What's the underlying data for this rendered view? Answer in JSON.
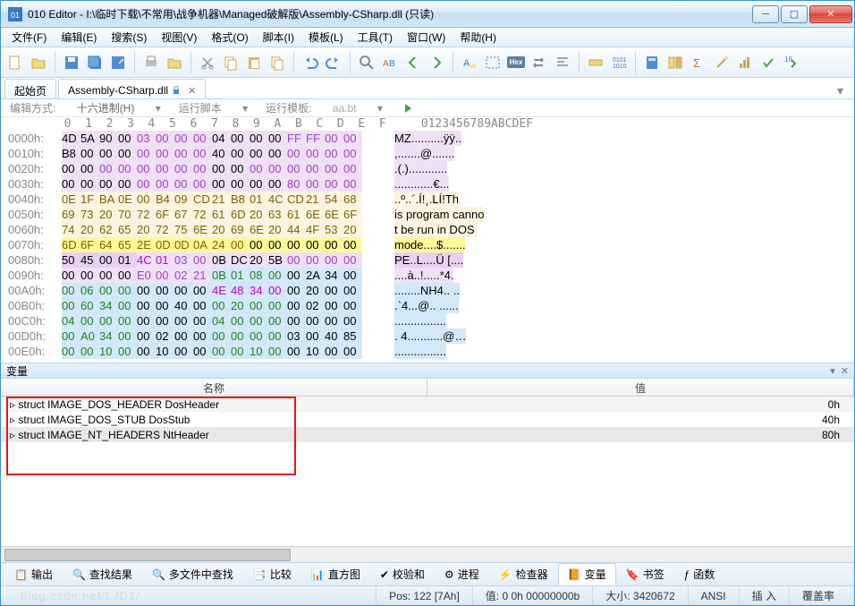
{
  "title": "010 Editor - I:\\临时下载\\不常用\\战争机器\\Managed破解版\\Assembly-CSharp.dll  (只读)",
  "menu": [
    "文件(F)",
    "编辑(E)",
    "搜索(S)",
    "视图(V)",
    "格式(O)",
    "脚本(I)",
    "模板(L)",
    "工具(T)",
    "窗口(W)",
    "帮助(H)"
  ],
  "tabs": {
    "start": "起始页",
    "file": "Assembly-CSharp.dll"
  },
  "hexhdr": {
    "mode_lbl": "编辑方式:",
    "mode": "十六进制(H)",
    "script_lbl": "运行脚本",
    "tpl_lbl": "运行模板:",
    "tpl": "aa.bt"
  },
  "ruler": "        0  1  2  3  4  5  6  7  8  9  A  B  C  D  E  F     0123456789ABCDEF",
  "rows": [
    {
      "a": "0000h:",
      "b": [
        "4D",
        "5A",
        "90",
        "00",
        "03",
        "00",
        "00",
        "00",
        "04",
        "00",
        "00",
        "00",
        "FF",
        "FF",
        "00",
        "00"
      ],
      "c": [
        "lav",
        "lav",
        "lav",
        "lav",
        "lav",
        "lav",
        "lav",
        "lav",
        "lav",
        "lav",
        "lav",
        "lav",
        "lav",
        "lav",
        "lav",
        "lav"
      ],
      "f": [
        "blk",
        "blk",
        "blk",
        "blk",
        "pur",
        "pur",
        "pur",
        "pur",
        "blk",
        "blk",
        "blk",
        "blk",
        "pur",
        "pur",
        "pur",
        "pur"
      ],
      "t": "MZ..........ÿÿ.."
    },
    {
      "a": "0010h:",
      "b": [
        "B8",
        "00",
        "00",
        "00",
        "00",
        "00",
        "00",
        "00",
        "40",
        "00",
        "00",
        "00",
        "00",
        "00",
        "00",
        "00"
      ],
      "c": [
        "lav",
        "lav",
        "lav",
        "lav",
        "lav",
        "lav",
        "lav",
        "lav",
        "lav",
        "lav",
        "lav",
        "lav",
        "lav",
        "lav",
        "lav",
        "lav"
      ],
      "f": [
        "blk",
        "blk",
        "blk",
        "blk",
        "pur",
        "pur",
        "pur",
        "pur",
        "blk",
        "blk",
        "blk",
        "blk",
        "pur",
        "pur",
        "pur",
        "pur"
      ],
      "t": ",.......@......."
    },
    {
      "a": "0020h:",
      "b": [
        "00",
        "00",
        "00",
        "00",
        "00",
        "00",
        "00",
        "00",
        "00",
        "00",
        "00",
        "00",
        "00",
        "00",
        "00",
        "00"
      ],
      "c": [
        "lav",
        "lav",
        "lav",
        "lav",
        "lav",
        "lav",
        "lav",
        "lav",
        "lav",
        "lav",
        "lav",
        "lav",
        "lav",
        "lav",
        "lav",
        "lav"
      ],
      "f": [
        "blk",
        "blk",
        "pur",
        "pur",
        "pur",
        "pur",
        "pur",
        "pur",
        "blk",
        "blk",
        "pur",
        "pur",
        "pur",
        "pur",
        "pur",
        "pur"
      ],
      "t": ".(.)............"
    },
    {
      "a": "0030h:",
      "b": [
        "00",
        "00",
        "00",
        "00",
        "00",
        "00",
        "00",
        "00",
        "00",
        "00",
        "00",
        "00",
        "80",
        "00",
        "00",
        "00"
      ],
      "c": [
        "lav",
        "lav",
        "lav",
        "lav",
        "lav",
        "lav",
        "lav",
        "lav",
        "lav",
        "lav",
        "lav",
        "lav",
        "lav",
        "lav",
        "lav",
        "lav"
      ],
      "f": [
        "blk",
        "blk",
        "blk",
        "blk",
        "pur",
        "pur",
        "pur",
        "pur",
        "blk",
        "blk",
        "blk",
        "blk",
        "pur",
        "pur",
        "pur",
        "pur"
      ],
      "t": "............€..."
    },
    {
      "a": "0040h:",
      "b": [
        "0E",
        "1F",
        "BA",
        "0E",
        "00",
        "B4",
        "09",
        "CD",
        "21",
        "B8",
        "01",
        "4C",
        "CD",
        "21",
        "54",
        "68"
      ],
      "c": [
        "pale",
        "pale",
        "pale",
        "pale",
        "pale",
        "pale",
        "pale",
        "pale",
        "pale",
        "pale",
        "pale",
        "pale",
        "pale",
        "pale",
        "pale",
        "pale"
      ],
      "f": [
        "brn",
        "brn",
        "brn",
        "brn",
        "brn",
        "brn",
        "brn",
        "brn",
        "brn",
        "brn",
        "brn",
        "brn",
        "brn",
        "brn",
        "brn",
        "brn"
      ],
      "t": "..º..´.Í!¸.LÍ!Th"
    },
    {
      "a": "0050h:",
      "b": [
        "69",
        "73",
        "20",
        "70",
        "72",
        "6F",
        "67",
        "72",
        "61",
        "6D",
        "20",
        "63",
        "61",
        "6E",
        "6E",
        "6F"
      ],
      "c": [
        "pale",
        "pale",
        "pale",
        "pale",
        "pale",
        "pale",
        "pale",
        "pale",
        "pale",
        "pale",
        "pale",
        "pale",
        "pale",
        "pale",
        "pale",
        "pale"
      ],
      "f": [
        "brn",
        "brn",
        "brn",
        "brn",
        "brn",
        "brn",
        "brn",
        "brn",
        "brn",
        "brn",
        "brn",
        "brn",
        "brn",
        "brn",
        "brn",
        "brn"
      ],
      "t": "is program canno"
    },
    {
      "a": "0060h:",
      "b": [
        "74",
        "20",
        "62",
        "65",
        "20",
        "72",
        "75",
        "6E",
        "20",
        "69",
        "6E",
        "20",
        "44",
        "4F",
        "53",
        "20"
      ],
      "c": [
        "pale",
        "pale",
        "pale",
        "pale",
        "pale",
        "pale",
        "pale",
        "pale",
        "pale",
        "pale",
        "pale",
        "pale",
        "pale",
        "pale",
        "pale",
        "pale"
      ],
      "f": [
        "brn",
        "brn",
        "brn",
        "brn",
        "brn",
        "brn",
        "brn",
        "brn",
        "brn",
        "brn",
        "brn",
        "brn",
        "brn",
        "brn",
        "brn",
        "brn"
      ],
      "t": "t be run in DOS "
    },
    {
      "a": "0070h:",
      "b": [
        "6D",
        "6F",
        "64",
        "65",
        "2E",
        "0D",
        "0D",
        "0A",
        "24",
        "00",
        "00",
        "00",
        "00",
        "00",
        "00",
        "00"
      ],
      "c": [
        "yel",
        "yel",
        "yel",
        "yel",
        "yel",
        "yel",
        "yel",
        "yel",
        "yel",
        "yel",
        "yel",
        "yel",
        "yel",
        "yel",
        "yel",
        "yel"
      ],
      "f": [
        "brn",
        "brn",
        "brn",
        "brn",
        "brn",
        "brn",
        "brn",
        "brn",
        "brn",
        "brn",
        "blk",
        "blk",
        "blk",
        "blk",
        "blk",
        "blk"
      ],
      "t": "mode....$......."
    },
    {
      "a": "0080h:",
      "b": [
        "50",
        "45",
        "00",
        "01",
        "4C",
        "01",
        "03",
        "00",
        "0B",
        "DC",
        "20",
        "5B",
        "00",
        "00",
        "00",
        "00"
      ],
      "c": [
        "lav2",
        "lav2",
        "lav2",
        "lav2",
        "lav",
        "lav",
        "lav",
        "lav",
        "lav",
        "lav",
        "lav",
        "lav",
        "lav",
        "lav",
        "lav",
        "lav"
      ],
      "f": [
        "blk",
        "blk",
        "blk",
        "blk",
        "mag",
        "mag",
        "pur",
        "pur",
        "blk",
        "blk",
        "blk",
        "blk",
        "pur",
        "pur",
        "pur",
        "pur"
      ],
      "t": "PE..L....Ü [...."
    },
    {
      "a": "0090h:",
      "b": [
        "00",
        "00",
        "00",
        "00",
        "E0",
        "00",
        "02",
        "21",
        "0B",
        "01",
        "08",
        "00",
        "00",
        "2A",
        "34",
        "00"
      ],
      "c": [
        "lav",
        "lav",
        "lav",
        "lav",
        "lav",
        "lav",
        "lav",
        "lav",
        "blu",
        "blu",
        "blu",
        "blu",
        "blu",
        "blu",
        "blu",
        "blu"
      ],
      "f": [
        "blk",
        "blk",
        "blk",
        "blk",
        "pur",
        "pur",
        "pur",
        "pur",
        "grn",
        "grn",
        "grn",
        "grn",
        "blk",
        "blk",
        "blk",
        "blk"
      ],
      "t": "....à..!.....*4."
    },
    {
      "a": "00A0h:",
      "b": [
        "00",
        "06",
        "00",
        "00",
        "00",
        "00",
        "00",
        "00",
        "4E",
        "48",
        "34",
        "00",
        "00",
        "20",
        "00",
        "00"
      ],
      "c": [
        "blu",
        "blu",
        "blu",
        "blu",
        "blu",
        "blu",
        "blu",
        "blu",
        "blu",
        "blu",
        "blu",
        "blu",
        "blu",
        "blu",
        "blu",
        "blu"
      ],
      "f": [
        "grn",
        "grn",
        "grn",
        "grn",
        "blk",
        "blk",
        "blk",
        "blk",
        "mag",
        "mag",
        "mag",
        "mag",
        "blk",
        "blk",
        "blk",
        "blk"
      ],
      "t": "........NH4.. .."
    },
    {
      "a": "00B0h:",
      "b": [
        "00",
        "60",
        "34",
        "00",
        "00",
        "00",
        "40",
        "00",
        "00",
        "20",
        "00",
        "00",
        "00",
        "02",
        "00",
        "00"
      ],
      "c": [
        "blu",
        "blu",
        "blu",
        "blu",
        "blu",
        "blu",
        "blu",
        "blu",
        "blu",
        "blu",
        "blu",
        "blu",
        "blu",
        "blu",
        "blu",
        "blu"
      ],
      "f": [
        "grn",
        "grn",
        "grn",
        "grn",
        "blk",
        "blk",
        "blk",
        "blk",
        "grn",
        "grn",
        "grn",
        "grn",
        "blk",
        "blk",
        "blk",
        "blk"
      ],
      "t": ".`4...@.. ......"
    },
    {
      "a": "00C0h:",
      "b": [
        "04",
        "00",
        "00",
        "00",
        "00",
        "00",
        "00",
        "00",
        "04",
        "00",
        "00",
        "00",
        "00",
        "00",
        "00",
        "00"
      ],
      "c": [
        "blu",
        "blu",
        "blu",
        "blu",
        "blu",
        "blu",
        "blu",
        "blu",
        "blu",
        "blu",
        "blu",
        "blu",
        "blu",
        "blu",
        "blu",
        "blu"
      ],
      "f": [
        "grn",
        "grn",
        "grn",
        "grn",
        "blk",
        "blk",
        "blk",
        "blk",
        "grn",
        "grn",
        "grn",
        "grn",
        "blk",
        "blk",
        "blk",
        "blk"
      ],
      "t": "................"
    },
    {
      "a": "00D0h:",
      "b": [
        "00",
        "A0",
        "34",
        "00",
        "00",
        "02",
        "00",
        "00",
        "00",
        "00",
        "00",
        "00",
        "03",
        "00",
        "40",
        "85"
      ],
      "c": [
        "blu",
        "blu",
        "blu",
        "blu",
        "blu",
        "blu",
        "blu",
        "blu",
        "blu",
        "blu",
        "blu",
        "blu",
        "blu",
        "blu",
        "blu",
        "blu"
      ],
      "f": [
        "grn",
        "grn",
        "grn",
        "grn",
        "blk",
        "blk",
        "blk",
        "blk",
        "grn",
        "grn",
        "grn",
        "grn",
        "blk",
        "blk",
        "blk",
        "blk"
      ],
      "t": ". 4...........@…"
    },
    {
      "a": "00E0h:",
      "b": [
        "00",
        "00",
        "10",
        "00",
        "00",
        "10",
        "00",
        "00",
        "00",
        "00",
        "10",
        "00",
        "00",
        "10",
        "00",
        "00"
      ],
      "c": [
        "blu",
        "blu",
        "blu",
        "blu",
        "blu",
        "blu",
        "blu",
        "blu",
        "blu",
        "blu",
        "blu",
        "blu",
        "blu",
        "blu",
        "blu",
        "blu"
      ],
      "f": [
        "grn",
        "grn",
        "grn",
        "grn",
        "blk",
        "blk",
        "blk",
        "blk",
        "grn",
        "grn",
        "grn",
        "grn",
        "blk",
        "blk",
        "blk",
        "blk"
      ],
      "t": "................"
    }
  ],
  "var_panel": "变量",
  "var_cols": {
    "name": "名称",
    "value": "值"
  },
  "var_rows": [
    {
      "n": "struct IMAGE_DOS_HEADER DosHeader",
      "v": "0h"
    },
    {
      "n": "struct IMAGE_DOS_STUB DosStub",
      "v": "40h"
    },
    {
      "n": "struct IMAGE_NT_HEADERS NtHeader",
      "v": "80h"
    }
  ],
  "btabs": [
    "输出",
    "查找结果",
    "多文件中查找",
    "比较",
    "直方图",
    "校验和",
    "进程",
    "检查器",
    "变量",
    "书签",
    "函数"
  ],
  "status": {
    "pos": "Pos: 122 [7Ah]",
    "val": "值: 0 0h 00000000b",
    "size": "大小: 3420672",
    "enc": "ANSI",
    "ins": "插 入",
    "ovw": "覆盖率"
  },
  "watermark": "blog.csdn.net/LJD1/"
}
